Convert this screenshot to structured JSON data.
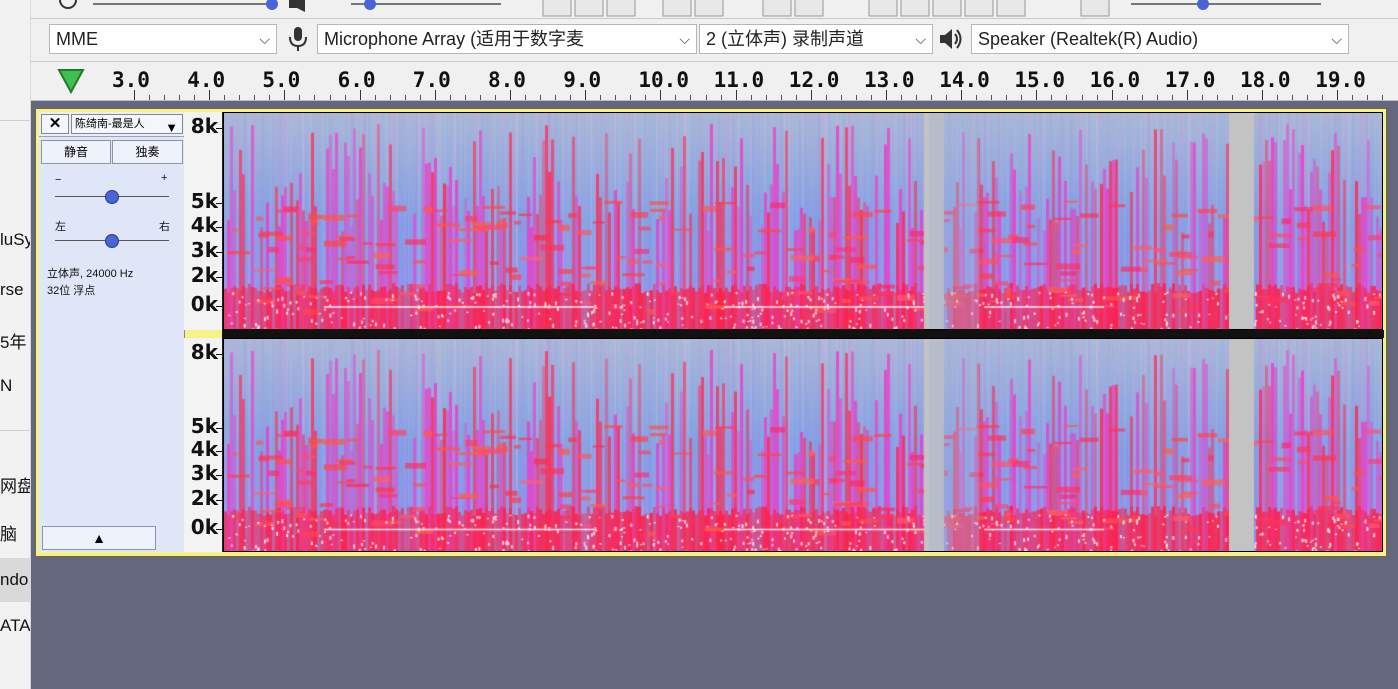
{
  "sidebar": {
    "items": [
      {
        "label": "luSy"
      },
      {
        "label": "rse"
      },
      {
        "label": "5年"
      },
      {
        "label": "N"
      },
      {
        "label": "网盘"
      },
      {
        "label": "脑"
      },
      {
        "label": "ndo"
      },
      {
        "label": "ATA"
      }
    ]
  },
  "device_bar": {
    "host": "MME",
    "recording_device": "Microphone Array (适用于数字麦",
    "recording_channels": "2 (立体声) 录制声道",
    "playback_device": "Speaker (Realtek(R) Audio)",
    "mic_icon": "microphone-icon",
    "speaker_icon": "speaker-icon"
  },
  "ruler": {
    "labels": [
      "3.0",
      "4.0",
      "5.0",
      "6.0",
      "7.0",
      "8.0",
      "9.0",
      "10.0",
      "11.0",
      "12.0",
      "13.0",
      "14.0",
      "15.0",
      "16.0",
      "17.0",
      "18.0",
      "19.0"
    ],
    "play_head_icon": "play-head-triangle-icon"
  },
  "track": {
    "close_label": "✕",
    "name": "陈绮南-最是人",
    "mute_label": "静音",
    "solo_label": "独奏",
    "gain_minus": "−",
    "gain_plus": "+",
    "pan_left": "左",
    "pan_right": "右",
    "gain_value": 0.5,
    "pan_value": 0.5,
    "info_line1": "立体声, 24000 Hz",
    "info_line2": "32位 浮点",
    "collapse_label": "▲"
  },
  "scale": {
    "labels": [
      "8k",
      "5k",
      "4k",
      "3k",
      "2k",
      "0k"
    ]
  },
  "colors": {
    "track_bg": "#f7f18a",
    "workspace": "#65677f",
    "spectro_low": "#7fa3e8",
    "spectro_high": "#ff2a4a",
    "spectro_peak": "#ffffff"
  }
}
